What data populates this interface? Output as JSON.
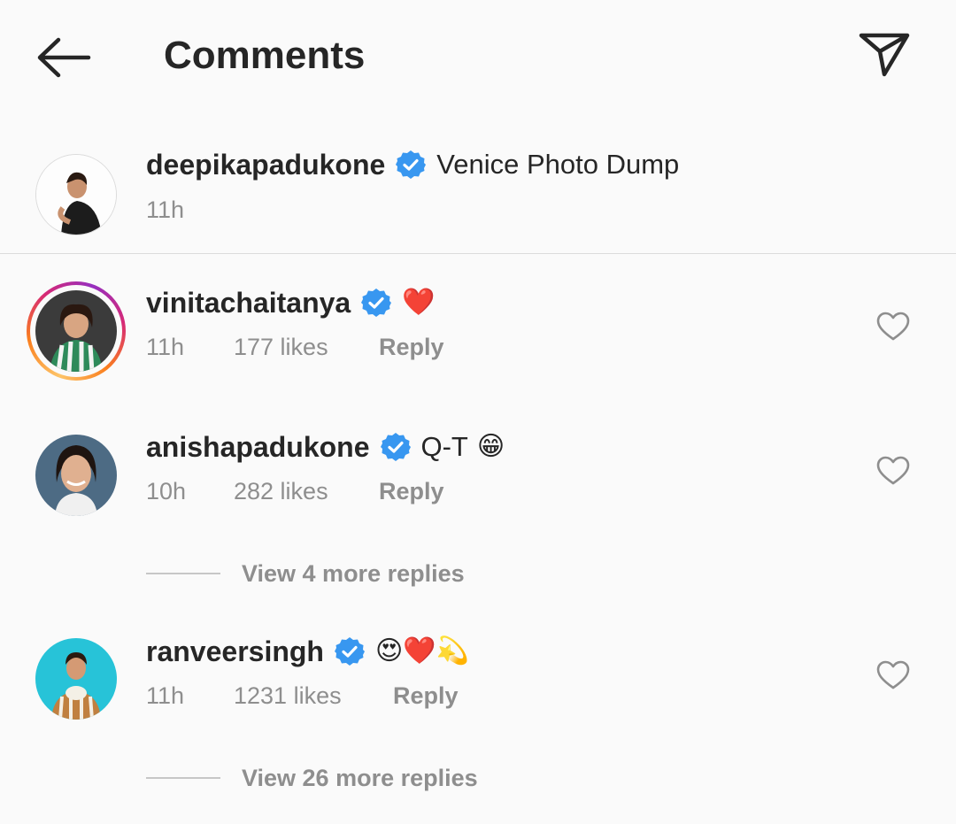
{
  "header": {
    "title": "Comments",
    "back_icon": "arrow-left-icon",
    "share_icon": "paper-plane-icon"
  },
  "caption": {
    "username": "deepikapadukone",
    "verified": true,
    "text": "Venice Photo Dump",
    "time": "11h"
  },
  "comments": [
    {
      "username": "vinitachaitanya",
      "verified": true,
      "text": "❤️",
      "time": "11h",
      "likes": "177 likes",
      "reply": "Reply",
      "story_ring": true
    },
    {
      "username": "anishapadukone",
      "verified": true,
      "text": "Q-T",
      "emoji": "😁",
      "time": "10h",
      "likes": "282 likes",
      "reply": "Reply",
      "more_replies": "View 4 more replies"
    },
    {
      "username": "ranveersingh",
      "verified": true,
      "text": "😍❤️💫",
      "time": "11h",
      "likes": "1231 likes",
      "reply": "Reply",
      "more_replies": "View 26 more replies"
    }
  ],
  "colors": {
    "verified_blue": "#3897f0",
    "secondary_text": "#8e8e8e",
    "divider": "#dbdbdb",
    "heart_red": "#ed1c3a"
  }
}
